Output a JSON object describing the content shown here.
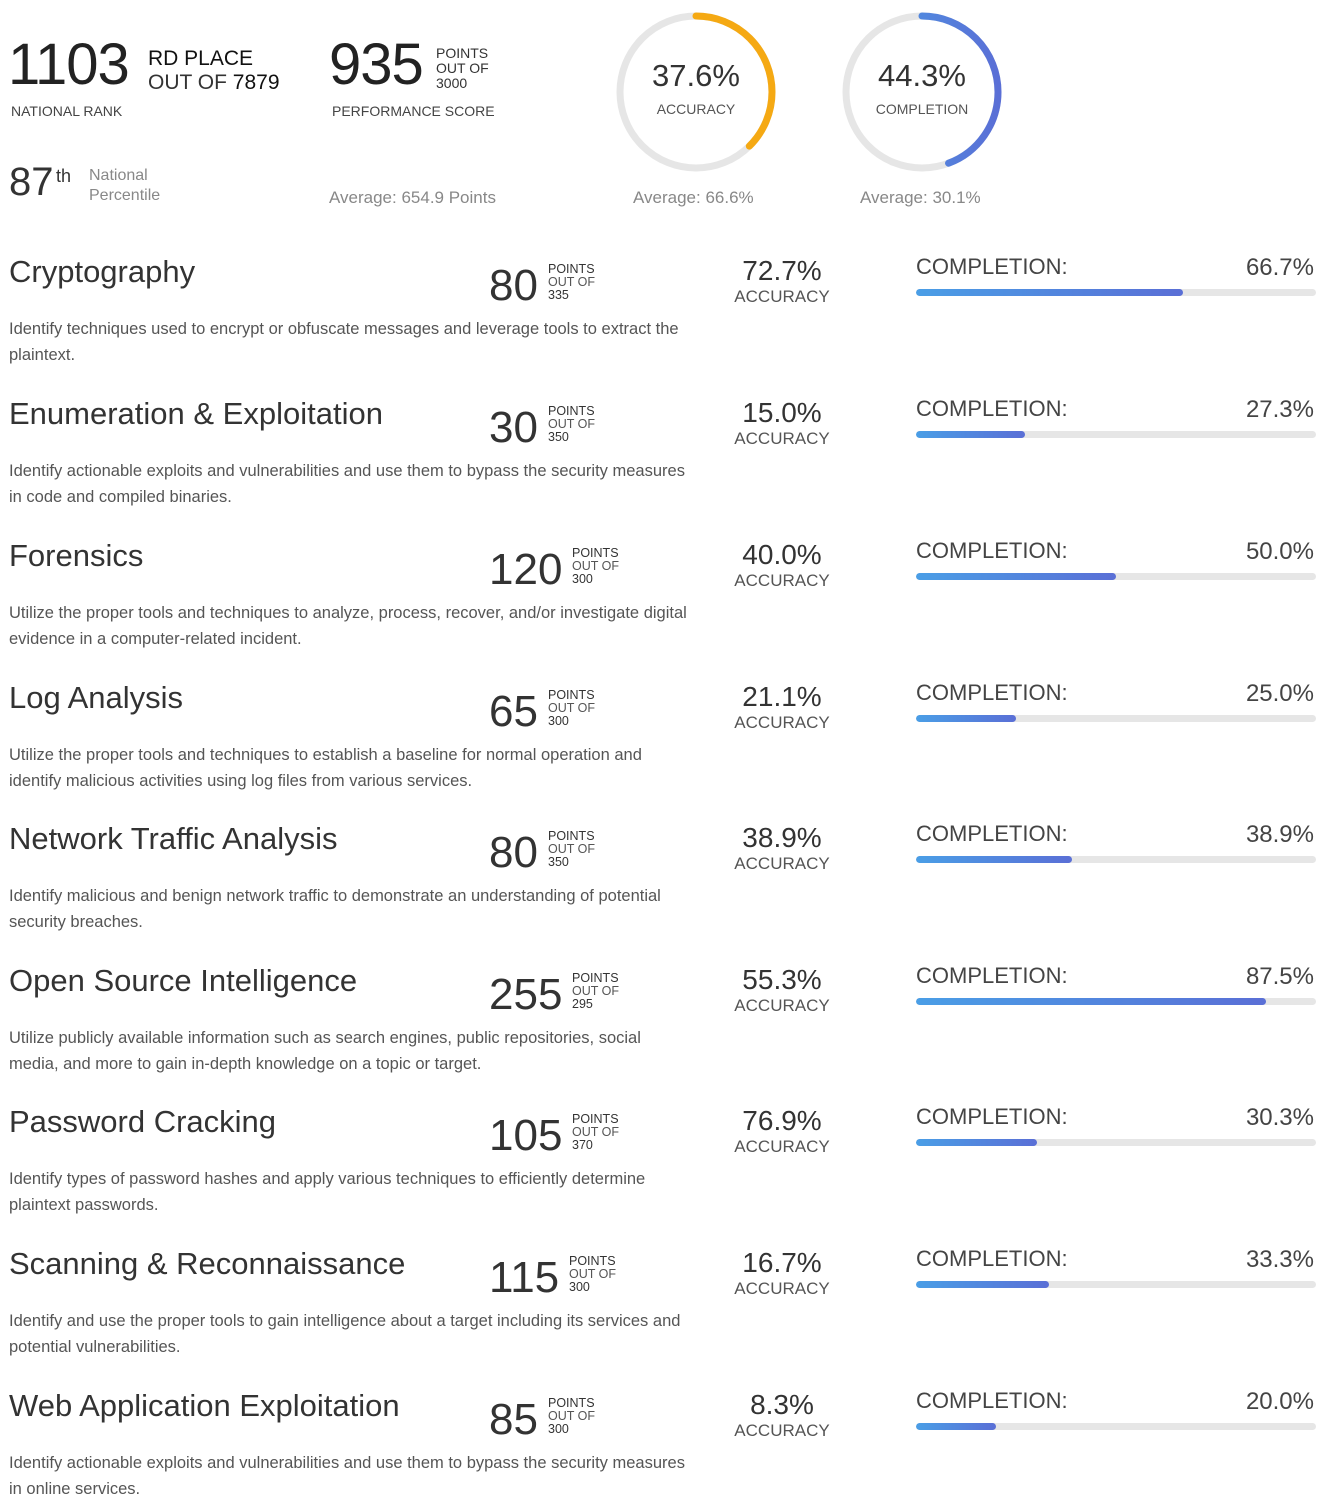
{
  "summary": {
    "rank": {
      "value": "1103",
      "suffix": "RD PLACE",
      "out_of_label": "OUT OF",
      "total": "7879",
      "label": "NATIONAL RANK"
    },
    "percentile": {
      "value": "87",
      "suffix": "th",
      "label_line1": "National",
      "label_line2": "Percentile"
    },
    "score": {
      "value": "935",
      "unit": "POINTS",
      "out_of_label": "OUT OF",
      "max": "3000",
      "label": "PERFORMANCE SCORE",
      "average": "Average: 654.9 Points"
    },
    "accuracy": {
      "value": "37.6%",
      "fraction": 0.376,
      "label": "ACCURACY",
      "average": "Average: 66.6%",
      "color": "#f5a913"
    },
    "completion": {
      "value": "44.3%",
      "fraction": 0.443,
      "label": "COMPLETION",
      "average": "Average: 30.1%",
      "color": "#4a8fe0"
    }
  },
  "labels": {
    "points": "POINTS",
    "out_of": "OUT OF",
    "accuracy": "ACCURACY",
    "completion": "COMPLETION:"
  },
  "colors": {
    "track": "#e6e6e6",
    "bar_start": "#4a9ee6",
    "bar_end": "#5a6fd6"
  },
  "categories": [
    {
      "name": "Cryptography",
      "points": "80",
      "max": "335",
      "accuracy": "72.7%",
      "completion": "66.7%",
      "completion_fraction": 0.667,
      "description": "Identify techniques used to encrypt or obfuscate messages and leverage tools to extract the plaintext."
    },
    {
      "name": "Enumeration & Exploitation",
      "points": "30",
      "max": "350",
      "accuracy": "15.0%",
      "completion": "27.3%",
      "completion_fraction": 0.273,
      "description": "Identify actionable exploits and vulnerabilities and use them to bypass the security measures in code and compiled binaries."
    },
    {
      "name": "Forensics",
      "points": "120",
      "max": "300",
      "accuracy": "40.0%",
      "completion": "50.0%",
      "completion_fraction": 0.5,
      "description": "Utilize the proper tools and techniques to analyze, process, recover, and/or investigate digital evidence in a computer-related incident."
    },
    {
      "name": "Log Analysis",
      "points": "65",
      "max": "300",
      "accuracy": "21.1%",
      "completion": "25.0%",
      "completion_fraction": 0.25,
      "description": "Utilize the proper tools and techniques to establish a baseline for normal operation and identify malicious activities using log files from various services."
    },
    {
      "name": "Network Traffic Analysis",
      "points": "80",
      "max": "350",
      "accuracy": "38.9%",
      "completion": "38.9%",
      "completion_fraction": 0.389,
      "description": "Identify malicious and benign network traffic to demonstrate an understanding of potential security breaches."
    },
    {
      "name": "Open Source Intelligence",
      "points": "255",
      "max": "295",
      "accuracy": "55.3%",
      "completion": "87.5%",
      "completion_fraction": 0.875,
      "description": "Utilize publicly available information such as search engines, public repositories, social media, and more to gain in-depth knowledge on a topic or target."
    },
    {
      "name": "Password Cracking",
      "points": "105",
      "max": "370",
      "accuracy": "76.9%",
      "completion": "30.3%",
      "completion_fraction": 0.303,
      "description": "Identify types of password hashes and apply various techniques to efficiently determine plaintext passwords."
    },
    {
      "name": "Scanning & Reconnaissance",
      "points": "115",
      "max": "300",
      "accuracy": "16.7%",
      "completion": "33.3%",
      "completion_fraction": 0.333,
      "description": "Identify and use the proper tools to gain intelligence about a target including its services and potential vulnerabilities."
    },
    {
      "name": "Web Application Exploitation",
      "points": "85",
      "max": "300",
      "accuracy": "8.3%",
      "completion": "20.0%",
      "completion_fraction": 0.2,
      "description": "Identify actionable exploits and vulnerabilities and use them to bypass the security measures in online services."
    }
  ]
}
